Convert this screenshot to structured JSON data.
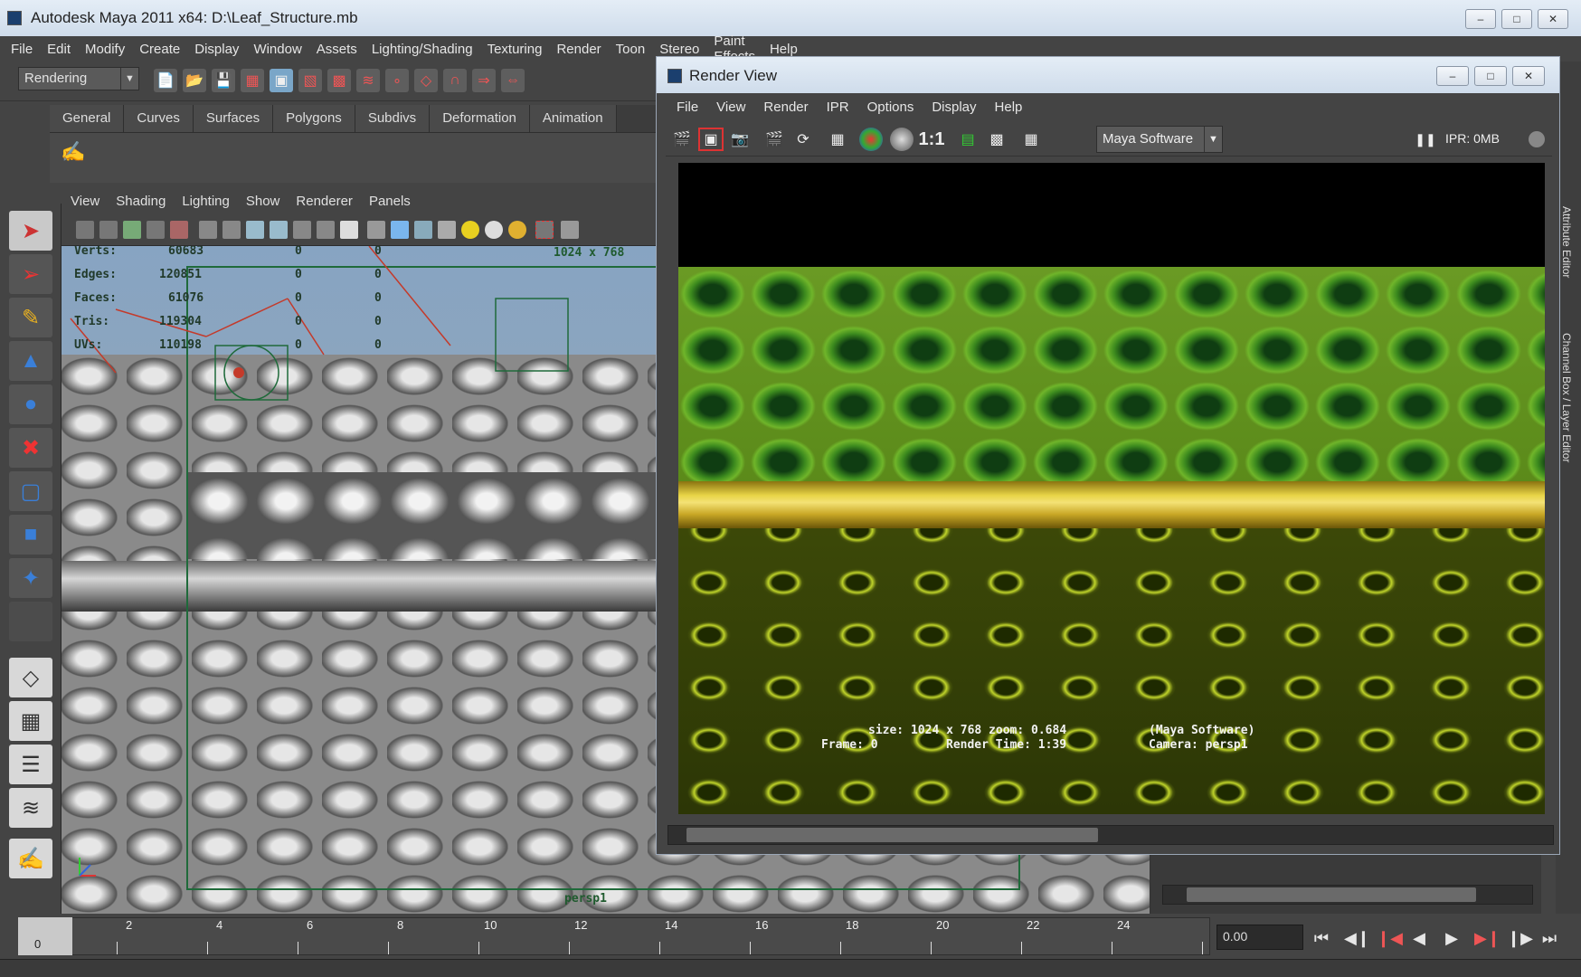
{
  "window": {
    "title": "Autodesk Maya 2011 x64: D:\\Leaf_Structure.mb"
  },
  "menubar": [
    "File",
    "Edit",
    "Modify",
    "Create",
    "Display",
    "Window",
    "Assets",
    "Lighting/Shading",
    "Texturing",
    "Render",
    "Toon",
    "Stereo",
    "Paint Effects",
    "Help"
  ],
  "toolbar": {
    "menu_set": "Rendering"
  },
  "shelf": {
    "tabs": [
      "General",
      "Curves",
      "Surfaces",
      "Polygons",
      "Subdivs",
      "Deformation",
      "Animation"
    ]
  },
  "viewport": {
    "menu": [
      "View",
      "Shading",
      "Lighting",
      "Show",
      "Renderer",
      "Panels"
    ],
    "hud": {
      "labels": [
        "Verts:",
        "Edges:",
        "Faces:",
        "Tris:",
        "UVs:"
      ],
      "values": [
        "60683",
        "120851",
        "61076",
        "119304",
        "110198"
      ],
      "col2": [
        "0",
        "0",
        "0",
        "0",
        "0"
      ],
      "col3": [
        "0",
        "0",
        "0",
        "0",
        "0"
      ],
      "resolution": "1024 x 768",
      "camera": "persp1"
    }
  },
  "render_view": {
    "title": "Render View",
    "menu": [
      "File",
      "View",
      "Render",
      "IPR",
      "Options",
      "Display",
      "Help"
    ],
    "renderer": "Maya Software",
    "ratio": "1:1",
    "ipr_status": "IPR: 0MB",
    "info": {
      "line1": "size: 1024 x 768 zoom: 0.684",
      "line1b": "(Maya Software)",
      "line2a": "Frame: 0",
      "line2b": "Render Time:  1:39",
      "line2c": "Camera: persp1"
    }
  },
  "side_tabs": [
    "Attribute Editor",
    "Channel Box / Layer Editor"
  ],
  "timeline": {
    "current_frame": "0",
    "ticks": [
      "0",
      "2",
      "4",
      "6",
      "8",
      "10",
      "12",
      "14",
      "16",
      "18",
      "20",
      "22",
      "24"
    ],
    "current_time": "0.00"
  },
  "colors": {
    "accent_green": "#1f6a3a",
    "leaf_yellow": "#e8d447",
    "hud_text": "#213a2a"
  }
}
